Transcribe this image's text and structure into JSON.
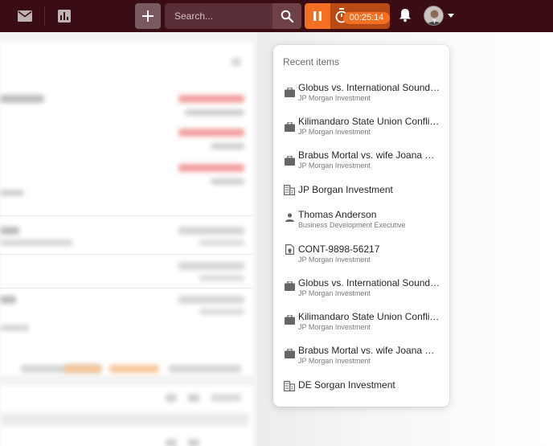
{
  "topbar": {
    "search_placeholder": "Search...",
    "timer": "00:25:14"
  },
  "icons": {
    "mail": "mail-icon",
    "reports": "bar-chart-icon",
    "add": "plus-icon",
    "search": "search-icon",
    "pause": "pause-icon",
    "stopwatch": "stopwatch-icon",
    "bell": "bell-icon",
    "caret": "chevron-down-icon"
  },
  "colors": {
    "topbar": "#3a0c14",
    "accent": "#f36f21",
    "timer_bg": "#b84a16"
  },
  "recent": {
    "title": "Recent items",
    "items": [
      {
        "icon": "briefcase",
        "title": "Globus vs. International Sound Mach…",
        "subtitle": "JP Morgan Investment"
      },
      {
        "icon": "briefcase",
        "title": "Kilimandaro State Union Conflict of I…",
        "subtitle": "JP Morgan Investment"
      },
      {
        "icon": "briefcase",
        "title": "Brabus Mortal vs. wife Joana Mortal",
        "subtitle": "JP Morgan Investment"
      },
      {
        "icon": "building",
        "title": "JP Borgan Investment",
        "subtitle": ""
      },
      {
        "icon": "person",
        "title": "Thomas Anderson",
        "subtitle": "Business Development Executive"
      },
      {
        "icon": "contract",
        "title": "CONT-9898-56217",
        "subtitle": "JP Morgan Investment"
      },
      {
        "icon": "briefcase",
        "title": "Globus vs. International Sound Mach…",
        "subtitle": "JP Morgan Investment"
      },
      {
        "icon": "briefcase",
        "title": "Kilimandaro State Union Conflict of I…",
        "subtitle": "JP Morgan Investment"
      },
      {
        "icon": "briefcase",
        "title": "Brabus Mortal vs. wife Joana Mortal",
        "subtitle": "JP Morgan Investment"
      },
      {
        "icon": "building",
        "title": "DE Sorgan Investment",
        "subtitle": ""
      }
    ]
  }
}
